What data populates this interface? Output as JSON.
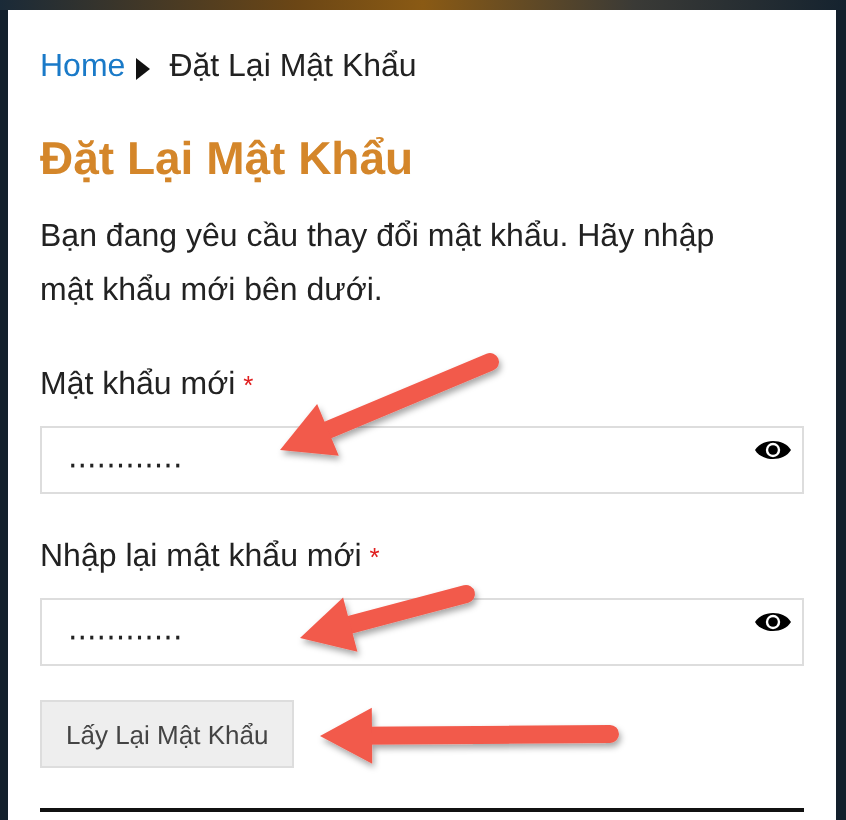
{
  "breadcrumb": {
    "items": [
      {
        "label": "Home",
        "kind": "link"
      },
      {
        "label": "Đặt Lại Mật Khẩu",
        "kind": "current"
      }
    ]
  },
  "title": "Đặt Lại Mật Khẩu",
  "intro": "Bạn đang yêu cầu thay đổi mật khẩu. Hãy nhập mật khẩu mới bên dưới.",
  "fields": [
    {
      "label": "Mật khẩu mới",
      "required": "*",
      "value": "············"
    },
    {
      "label": "Nhập lại mật khẩu mới",
      "required": "*",
      "value": "············"
    }
  ],
  "submit_button": "Lấy Lại Mật Khẩu"
}
